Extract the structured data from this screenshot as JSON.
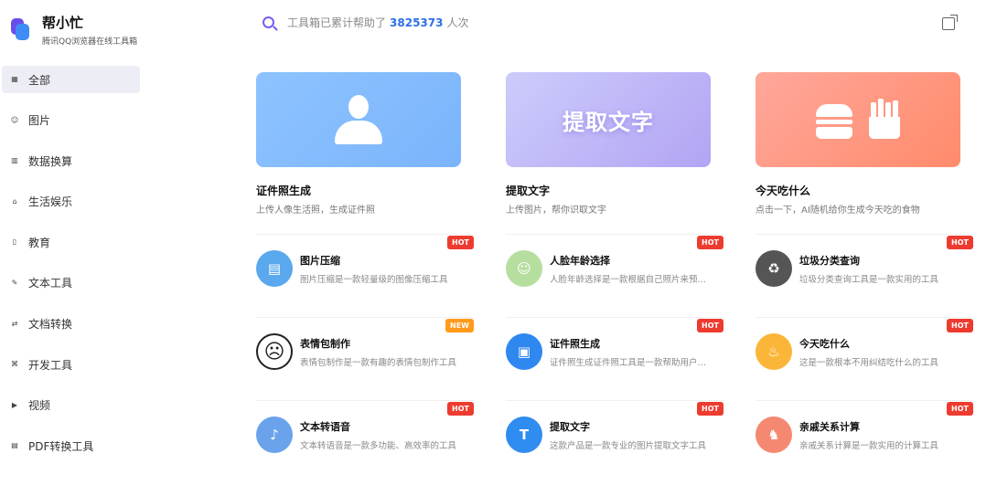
{
  "app": {
    "title": "帮小忙",
    "subtitle": "腾讯QQ浏览器在线工具箱"
  },
  "sidebar": {
    "items": [
      {
        "label": "全部",
        "icon": "grid-icon",
        "active": true
      },
      {
        "label": "图片",
        "icon": "image-icon"
      },
      {
        "label": "数据换算",
        "icon": "chart-icon"
      },
      {
        "label": "生活娱乐",
        "icon": "life-icon"
      },
      {
        "label": "教育",
        "icon": "education-icon"
      },
      {
        "label": "文本工具",
        "icon": "text-icon"
      },
      {
        "label": "文档转换",
        "icon": "document-icon"
      },
      {
        "label": "开发工具",
        "icon": "code-icon"
      },
      {
        "label": "视频",
        "icon": "video-icon"
      },
      {
        "label": "PDF转换工具",
        "icon": "pdf-icon"
      }
    ]
  },
  "search": {
    "prefix": "工具箱已累计帮助了",
    "count": "3825373",
    "suffix": "人次"
  },
  "featured": [
    {
      "title": "证件照生成",
      "desc": "上传人像生活照，生成证件照",
      "color1": "#8ec3ff",
      "color2": "#7ab4fb"
    },
    {
      "title": "提取文字",
      "desc": "上传图片，帮你识取文字",
      "banner_text": "提取文字",
      "color1": "#ccccfb",
      "color2": "#b2a4f4"
    },
    {
      "title": "今天吃什么",
      "desc": "点击一下，AI随机给你生成今天吃的食物",
      "color1": "#ffa79b",
      "color2": "#ff8b6b"
    }
  ],
  "tools": [
    {
      "title": "图片压缩",
      "desc": "图片压缩是一款轻量级的图像压缩工具",
      "badge": "HOT",
      "badge_type": "hot",
      "icon": "image-compress-icon",
      "color": "#5aa8ee",
      "glyph": "▤"
    },
    {
      "title": "人脸年龄选择",
      "desc": "人脸年龄选择是一款根据自己照片来预测年龄的工具",
      "badge": "HOT",
      "badge_type": "hot",
      "icon": "face-age-icon",
      "color": "#b6df9f",
      "glyph": "☺"
    },
    {
      "title": "垃圾分类查询",
      "desc": "垃圾分类查询工具是一款实用的工具",
      "badge": "HOT",
      "badge_type": "hot",
      "icon": "trash-bin-icon",
      "color": "#555555",
      "glyph": "♻"
    },
    {
      "title": "表情包制作",
      "desc": "表情包制作是一款有趣的表情包制作工具",
      "badge": "NEW",
      "badge_type": "new",
      "icon": "emoji-face-icon",
      "color": "#ffffff",
      "glyph": "☹"
    },
    {
      "title": "证件照生成",
      "desc": "证件照生成证件照工具是一款帮助用户生成证件照的工具",
      "badge": "HOT",
      "badge_type": "hot",
      "icon": "id-photo-icon",
      "color": "#2f87f0",
      "glyph": "▣"
    },
    {
      "title": "今天吃什么",
      "desc": "这是一款根本不用纠结吃什么的工具",
      "badge": "HOT",
      "badge_type": "hot",
      "icon": "food-icon",
      "color": "#fbb63a",
      "glyph": "♨"
    },
    {
      "title": "文本转语音",
      "desc": "文本转语音是一款多功能、高效率的工具",
      "badge": "HOT",
      "badge_type": "hot",
      "icon": "text-to-speech-icon",
      "color": "#6aa3ec",
      "glyph": "♪"
    },
    {
      "title": "提取文字",
      "desc": "这款产品是一款专业的图片提取文字工具",
      "badge": "HOT",
      "badge_type": "hot",
      "icon": "extract-text-icon",
      "color": "#2f8cf0",
      "glyph": "T"
    },
    {
      "title": "亲戚关系计算",
      "desc": "亲戚关系计算是一款实用的计算工具",
      "badge": "HOT",
      "badge_type": "hot",
      "icon": "relatives-icon",
      "color": "#f58870",
      "glyph": "♞"
    }
  ]
}
